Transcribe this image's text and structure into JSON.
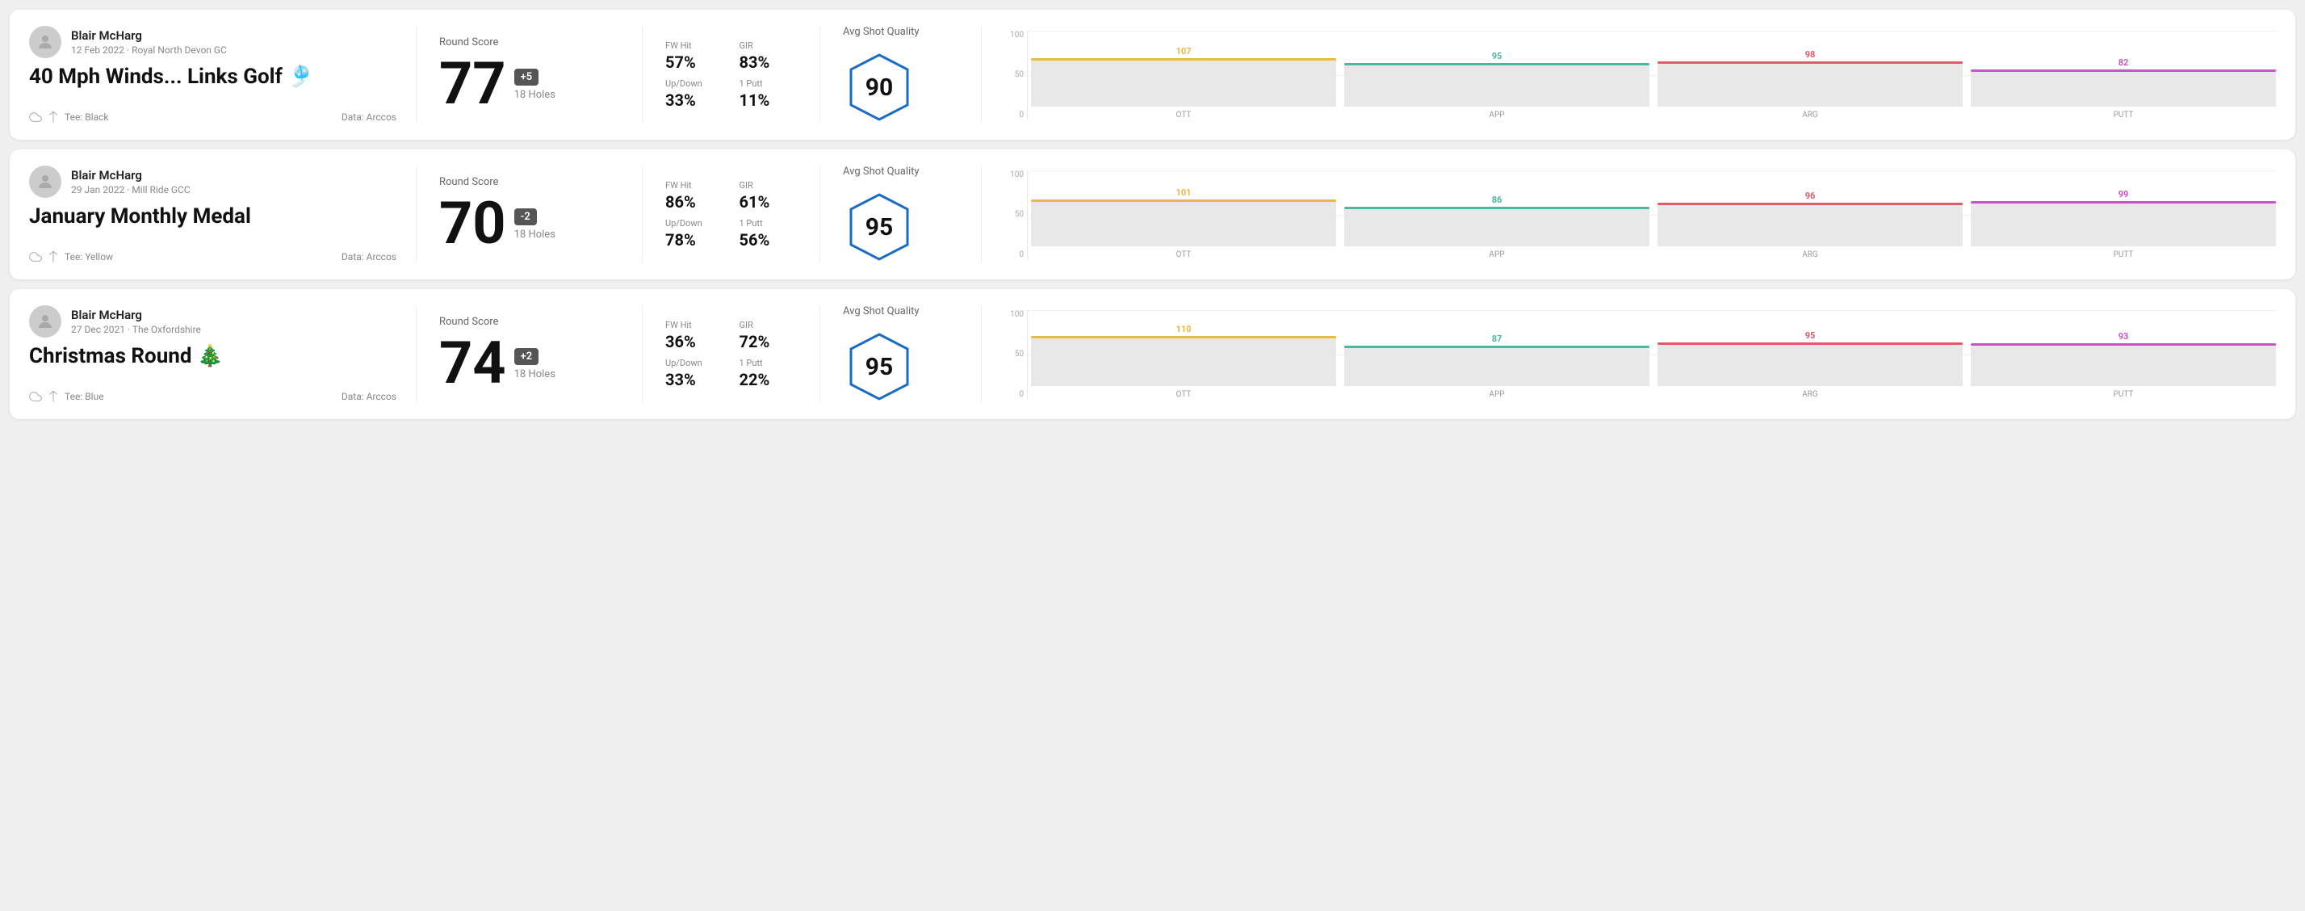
{
  "rounds": [
    {
      "id": "round1",
      "user": {
        "name": "Blair McHarg",
        "date_course": "12 Feb 2022 · Royal North Devon GC"
      },
      "title": "40 Mph Winds... Links Golf 🎐",
      "tee": "Black",
      "data_source": "Data: Arccos",
      "score": "77",
      "score_diff": "+5",
      "score_diff_type": "over",
      "holes": "18 Holes",
      "fw_hit": "57%",
      "gir": "83%",
      "up_down": "33%",
      "one_putt": "11%",
      "avg_shot_quality": "90",
      "chart": {
        "columns": [
          {
            "label": "OTT",
            "value": 107,
            "color": "#e8b84b",
            "pct": 75
          },
          {
            "label": "APP",
            "value": 95,
            "color": "#4db8a0",
            "pct": 68
          },
          {
            "label": "ARG",
            "value": 98,
            "color": "#e05a6a",
            "pct": 70
          },
          {
            "label": "PUTT",
            "value": 82,
            "color": "#c855c8",
            "pct": 58
          }
        ]
      }
    },
    {
      "id": "round2",
      "user": {
        "name": "Blair McHarg",
        "date_course": "29 Jan 2022 · Mill Ride GCC"
      },
      "title": "January Monthly Medal",
      "tee": "Yellow",
      "data_source": "Data: Arccos",
      "score": "70",
      "score_diff": "-2",
      "score_diff_type": "under",
      "holes": "18 Holes",
      "fw_hit": "86%",
      "gir": "61%",
      "up_down": "78%",
      "one_putt": "56%",
      "avg_shot_quality": "95",
      "chart": {
        "columns": [
          {
            "label": "OTT",
            "value": 101,
            "color": "#e8b84b",
            "pct": 72
          },
          {
            "label": "APP",
            "value": 86,
            "color": "#4db8a0",
            "pct": 61
          },
          {
            "label": "ARG",
            "value": 96,
            "color": "#e05a6a",
            "pct": 68
          },
          {
            "label": "PUTT",
            "value": 99,
            "color": "#c855c8",
            "pct": 70
          }
        ]
      }
    },
    {
      "id": "round3",
      "user": {
        "name": "Blair McHarg",
        "date_course": "27 Dec 2021 · The Oxfordshire"
      },
      "title": "Christmas Round 🎄",
      "tee": "Blue",
      "data_source": "Data: Arccos",
      "score": "74",
      "score_diff": "+2",
      "score_diff_type": "over",
      "holes": "18 Holes",
      "fw_hit": "36%",
      "gir": "72%",
      "up_down": "33%",
      "one_putt": "22%",
      "avg_shot_quality": "95",
      "chart": {
        "columns": [
          {
            "label": "OTT",
            "value": 110,
            "color": "#e8b84b",
            "pct": 78
          },
          {
            "label": "APP",
            "value": 87,
            "color": "#4db8a0",
            "pct": 62
          },
          {
            "label": "ARG",
            "value": 95,
            "color": "#e05a6a",
            "pct": 68
          },
          {
            "label": "PUTT",
            "value": 93,
            "color": "#c855c8",
            "pct": 66
          }
        ]
      }
    }
  ],
  "labels": {
    "round_score": "Round Score",
    "fw_hit": "FW Hit",
    "gir": "GIR",
    "up_down": "Up/Down",
    "one_putt": "1 Putt",
    "avg_shot_quality": "Avg Shot Quality",
    "chart_y_100": "100",
    "chart_y_50": "50",
    "chart_y_0": "0"
  }
}
